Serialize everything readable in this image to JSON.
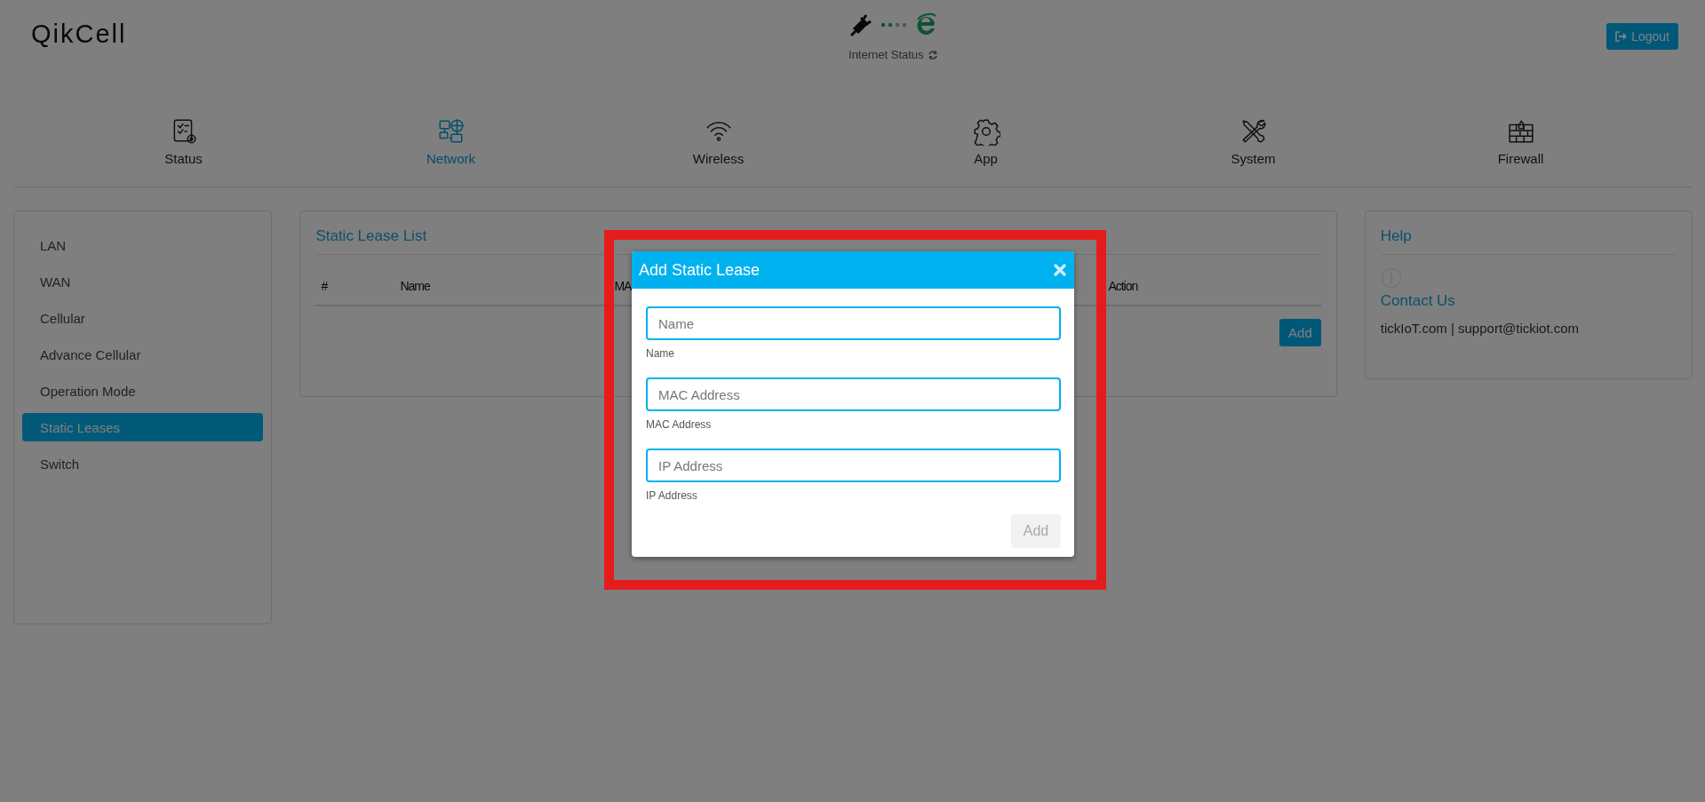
{
  "header": {
    "logo": "QikCell",
    "internet_status": "Internet Status",
    "logout_button": "Logout"
  },
  "nav": [
    {
      "label": "Status",
      "kind": "checklist",
      "selected": false
    },
    {
      "label": "Network",
      "kind": "network",
      "selected": true
    },
    {
      "label": "Wireless",
      "kind": "wifi",
      "selected": false
    },
    {
      "label": "App",
      "kind": "gear",
      "selected": false
    },
    {
      "label": "System",
      "kind": "tools",
      "selected": false
    },
    {
      "label": "Firewall",
      "kind": "firewall",
      "selected": false
    }
  ],
  "sidebar": {
    "items": [
      {
        "label": "LAN",
        "selected": false
      },
      {
        "label": "WAN",
        "selected": false
      },
      {
        "label": "Cellular",
        "selected": false
      },
      {
        "label": "Advance Cellular",
        "selected": false
      },
      {
        "label": "Operation Mode",
        "selected": false
      },
      {
        "label": "Static Leases",
        "selected": true
      },
      {
        "label": "Switch",
        "selected": false
      }
    ]
  },
  "static_lease_list": {
    "title": "Static Lease List",
    "columns": [
      "#",
      "Name",
      "MA",
      "Action"
    ],
    "add_button": "Add"
  },
  "help": {
    "title": "Help",
    "contact_title": "Contact Us",
    "contact_text": "tickIoT.com | support@tickiot.com"
  },
  "modal": {
    "title": "Add Static Lease",
    "fields": [
      {
        "placeholder": "Name",
        "label": "Name"
      },
      {
        "placeholder": "MAC Address",
        "label": "MAC Address"
      },
      {
        "placeholder": "IP Address",
        "label": "IP Address"
      }
    ],
    "add_button": {
      "label": "Add",
      "disabled": true
    }
  }
}
